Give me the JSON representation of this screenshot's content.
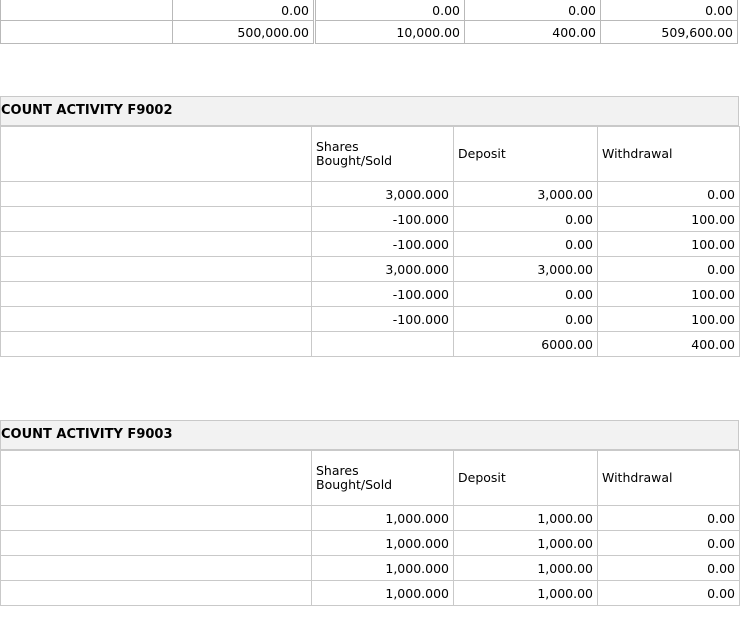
{
  "summary_rows": [
    [
      "0.00",
      "0.00",
      "0.00",
      "0.00"
    ],
    [
      "500,000.00",
      "10,000.00",
      "400.00",
      "509,600.00"
    ]
  ],
  "sections": [
    {
      "title": "COUNT ACTIVITY F9002",
      "headers": [
        "",
        "Shares\nBought/Sold",
        "Deposit",
        "Withdrawal"
      ],
      "rows": [
        [
          "",
          "3,000.000",
          "3,000.00",
          "0.00"
        ],
        [
          "",
          "-100.000",
          "0.00",
          "100.00"
        ],
        [
          "",
          "-100.000",
          "0.00",
          "100.00"
        ],
        [
          "",
          "3,000.000",
          "3,000.00",
          "0.00"
        ],
        [
          "",
          "-100.000",
          "0.00",
          "100.00"
        ],
        [
          "",
          "-100.000",
          "0.00",
          "100.00"
        ],
        [
          "",
          "",
          "6000.00",
          "400.00"
        ]
      ]
    },
    {
      "title": "COUNT ACTIVITY F9003",
      "headers": [
        "",
        "Shares\nBought/Sold",
        "Deposit",
        "Withdrawal"
      ],
      "rows": [
        [
          "",
          "1,000.000",
          "1,000.00",
          "0.00"
        ],
        [
          "",
          "1,000.000",
          "1,000.00",
          "0.00"
        ],
        [
          "",
          "1,000.000",
          "1,000.00",
          "0.00"
        ],
        [
          "",
          "1,000.000",
          "1,000.00",
          "0.00"
        ]
      ]
    }
  ]
}
